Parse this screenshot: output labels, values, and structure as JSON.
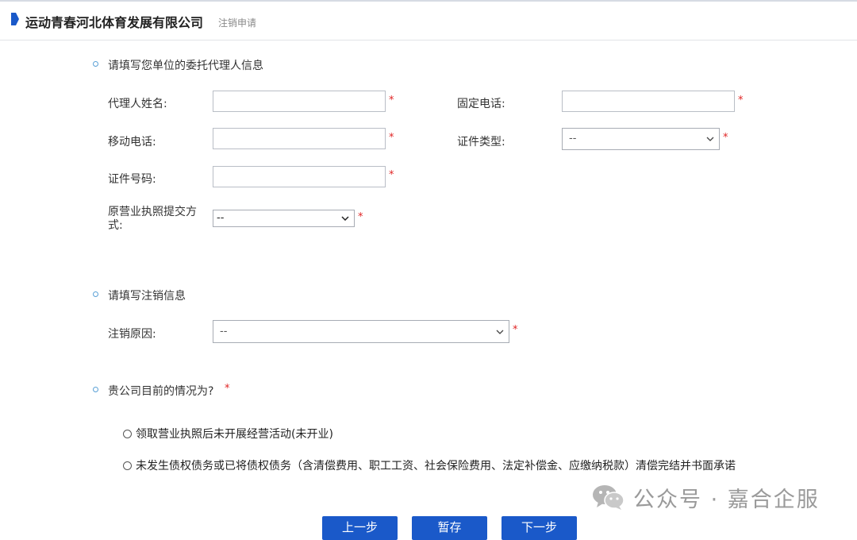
{
  "header": {
    "company": "运动青春河北体育发展有限公司",
    "page": "注销申请"
  },
  "section1": {
    "title": "请填写您单位的委托代理人信息",
    "fields": {
      "agent_name": {
        "label": "代理人姓名:",
        "value": ""
      },
      "landline": {
        "label": "固定电话:",
        "value": ""
      },
      "mobile": {
        "label": "移动电话:",
        "value": ""
      },
      "id_type": {
        "label": "证件类型:",
        "selected": "--"
      },
      "id_number": {
        "label": "证件号码:",
        "value": ""
      },
      "license_submit": {
        "label": "原营业执照提交方式:",
        "selected": "--"
      }
    }
  },
  "section2": {
    "title": "请填写注销信息",
    "reason": {
      "label": "注销原因:",
      "selected": "--"
    }
  },
  "section3": {
    "title": "贵公司目前的情况为?",
    "options": [
      "领取营业执照后未开展经营活动(未开业)",
      "未发生债权债务或已将债权债务（含清偿费用、职工工资、社会保险费用、法定补偿金、应缴纳税款）清偿完结并书面承诺"
    ]
  },
  "buttons": {
    "prev": "上一步",
    "save": "暂存",
    "next": "下一步"
  },
  "required_mark": "*",
  "watermark": "公众号 · 嘉合企服",
  "colors": {
    "accent": "#1a59c9",
    "required": "#e02424",
    "section_dot": "#5aa0d6"
  }
}
